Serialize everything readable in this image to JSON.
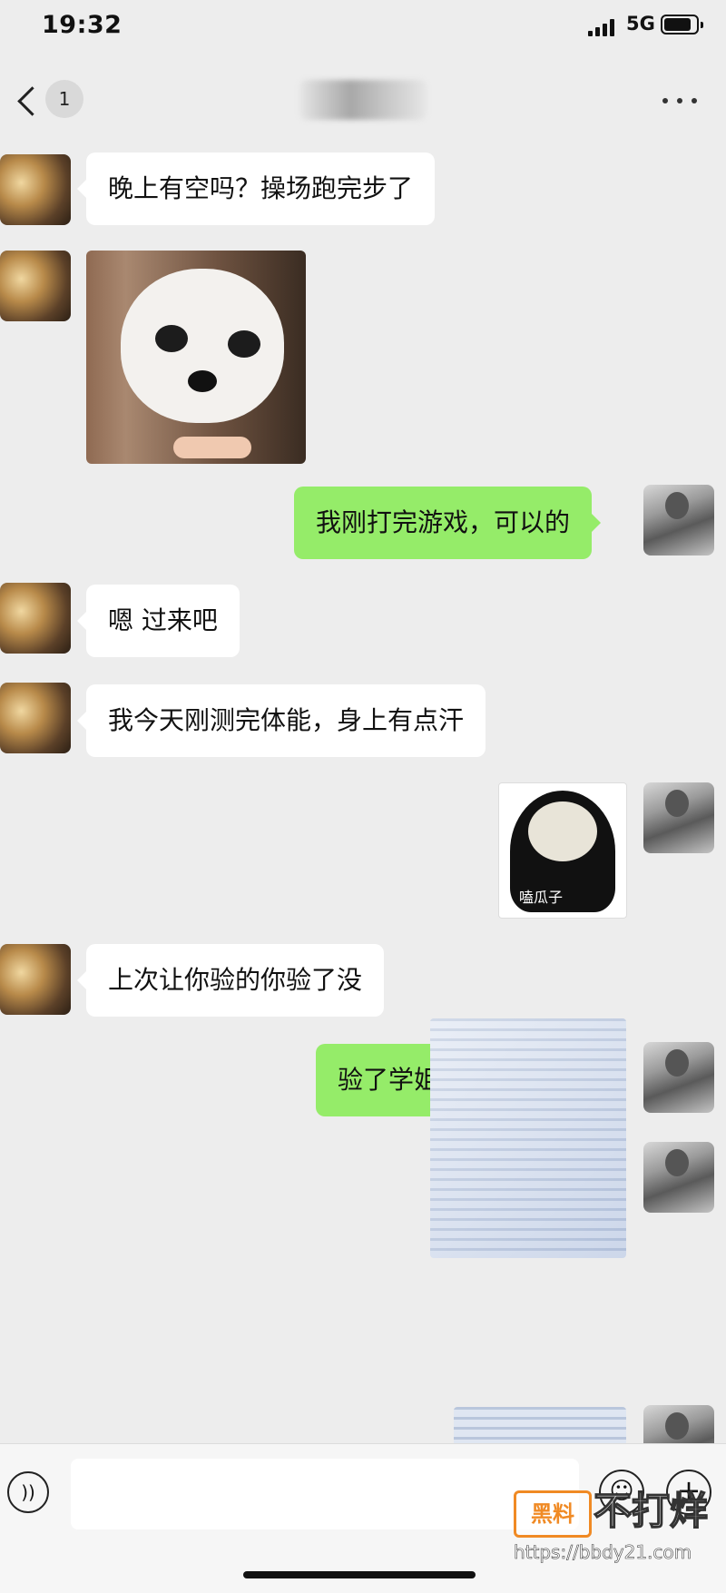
{
  "status_bar": {
    "time": "19:32",
    "network": "5G",
    "battery_level": 0.85
  },
  "nav_bar": {
    "unread_count": "1",
    "title": ""
  },
  "messages": [
    {
      "from": "them",
      "type": "text",
      "text": "晚上有空吗？操场跑完步了"
    },
    {
      "from": "them",
      "type": "image",
      "image": "chihuahua-meme"
    },
    {
      "from": "me",
      "type": "text",
      "text": "我刚打完游戏，可以的"
    },
    {
      "from": "them",
      "type": "text",
      "text": "嗯 过来吧"
    },
    {
      "from": "them",
      "type": "text",
      "text": "我今天刚测完体能，身上有点汗"
    },
    {
      "from": "me",
      "type": "image",
      "image": "panda-meme",
      "caption": "嗑瓜子"
    },
    {
      "from": "them",
      "type": "text",
      "text": "上次让你验的你验了没"
    },
    {
      "from": "me",
      "type": "text",
      "text": "验了学姐 你自己看嘛"
    },
    {
      "from": "me",
      "type": "image",
      "image": "medical-report"
    },
    {
      "from": "me",
      "type": "image",
      "image": "medical-report-partial"
    }
  ],
  "input_bar": {
    "placeholder": ""
  },
  "watermark": {
    "badge": "黑料",
    "text": "不打烊",
    "url": "https://bbdy21.com"
  },
  "colors": {
    "background": "#ededed",
    "my_bubble": "#95ec69",
    "their_bubble": "#ffffff"
  }
}
